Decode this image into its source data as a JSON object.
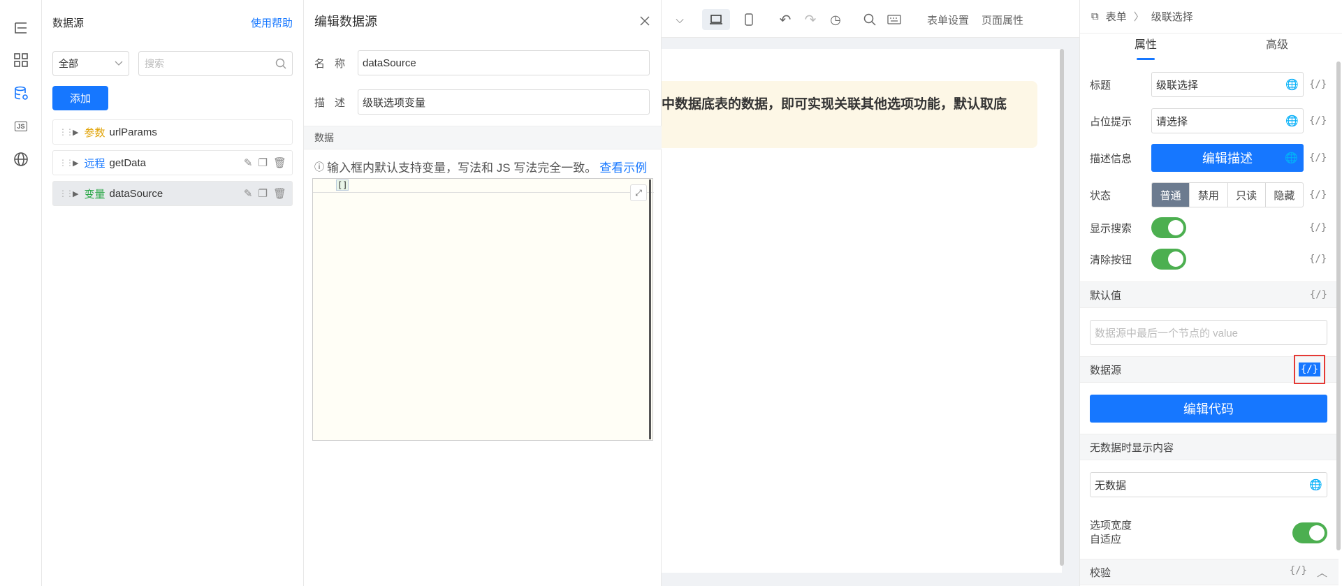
{
  "rail": {
    "icons": [
      "tree-icon",
      "grid-icon",
      "database-icon",
      "js-icon",
      "globe-icon"
    ],
    "js_label": "JS"
  },
  "datasource": {
    "title": "数据源",
    "help": "使用帮助",
    "filter": "全部",
    "search_placeholder": "搜索",
    "add": "添加",
    "items": [
      {
        "kind": "参数",
        "name": "urlParams"
      },
      {
        "kind": "远程",
        "name": "getData"
      },
      {
        "kind": "变量",
        "name": "dataSource"
      }
    ]
  },
  "editor": {
    "title": "编辑数据源",
    "name_label": "名称",
    "name_value": "dataSource",
    "desc_label": "描述",
    "desc_value": "级联选项变量",
    "data_section": "数据",
    "hint": "输入框内默认支持变量，写法和 JS 写法完全一致。",
    "hint_link": "查看示例",
    "code": "[]"
  },
  "toolbar": {
    "form_settings": "表单设置",
    "page_props": "页面属性"
  },
  "canvas": {
    "notice": "中数据底表的数据，即可实现关联其他选项功能，默认取底"
  },
  "props": {
    "crumb_form": "表单",
    "crumb_current": "级联选择",
    "tab_props": "属性",
    "tab_advanced": "高级",
    "title_label": "标题",
    "title_value": "级联选择",
    "placeholder_label": "占位提示",
    "placeholder_value": "请选择",
    "desc_label": "描述信息",
    "desc_button": "编辑描述",
    "state_label": "状态",
    "states": [
      "普通",
      "禁用",
      "只读",
      "隐藏"
    ],
    "search_label": "显示搜索",
    "clear_label": "清除按钮",
    "default_section": "默认值",
    "default_placeholder": "数据源中最后一个节点的 value",
    "datasource_section": "数据源",
    "edit_code": "编辑代码",
    "empty_section": "无数据时显示内容",
    "empty_value": "无数据",
    "autowidth_label": "选项宽度自适应",
    "validate_section": "校验",
    "var_icon": "{/}"
  },
  "colors": {
    "accent": "#1677ff",
    "switch_on": "#4caf50",
    "highlight": "#e53935"
  }
}
